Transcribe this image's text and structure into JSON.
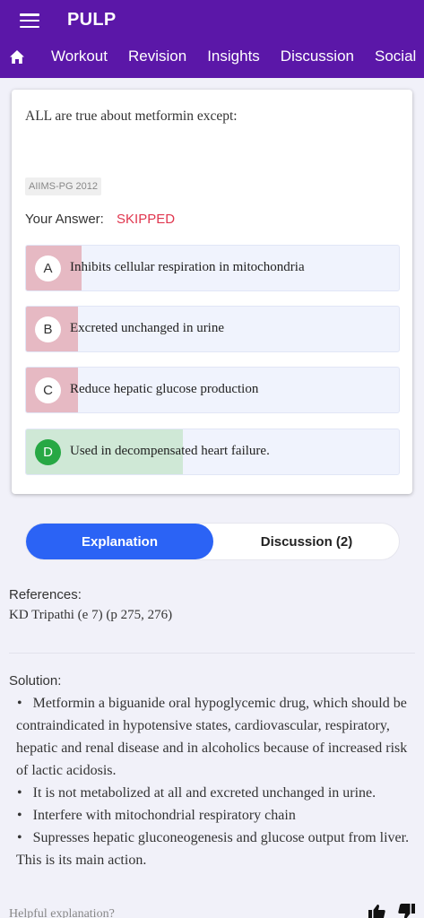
{
  "app": {
    "title": "PULP"
  },
  "icons": {
    "menu": "menu-icon",
    "home": "home-icon",
    "like": "thumbs-up-icon",
    "dislike": "thumbs-down-icon"
  },
  "nav": {
    "items": [
      "Workout",
      "Revision",
      "Insights",
      "Discussion",
      "Social"
    ]
  },
  "question": {
    "text": "ALL are true about metformin except:",
    "tag": "AIIMS-PG 2012",
    "answer_label": "Your Answer:",
    "answer_value": "SKIPPED",
    "options": [
      {
        "letter": "A",
        "text": "Inhibits cellular respiration in mitochondria",
        "response_percent": 15
      },
      {
        "letter": "B",
        "text": "Excreted unchanged in urine",
        "response_percent": 14
      },
      {
        "letter": "C",
        "text": "Reduce hepatic glucose production",
        "response_percent": 14
      },
      {
        "letter": "D",
        "text": "Used in decompensated heart failure.",
        "response_percent": 42,
        "correct": true
      }
    ]
  },
  "tabs": {
    "explanation": "Explanation",
    "discussion": "Discussion (2)"
  },
  "explanation": {
    "references_title": "References:",
    "references_text": "KD Tripathi (e 7) (p 275, 276)",
    "solution_title": "Solution:",
    "solution_points": [
      "Metformin a biguanide oral hypoglycemic drug, which should be contraindicated in hypotensive states, cardiovascular, respiratory, hepatic and renal disease and in alcoholics because of increased risk of lactic acidosis.",
      "It is not metabolized at all and excreted unchanged in urine.",
      "Interfere with mitochondrial respiratory chain",
      "Supresses hepatic gluconeogenesis and glucose output from liver. This is its main action."
    ],
    "helpful_prompt": "Helpful explanation?"
  },
  "colors": {
    "header": "#5b17a8",
    "tab_active": "#2b63f5",
    "answer_skipped": "#e0364e",
    "wrong_fill": "#e6b9c3",
    "correct_fill": "#cfe8d6",
    "correct_badge": "#27a844"
  }
}
